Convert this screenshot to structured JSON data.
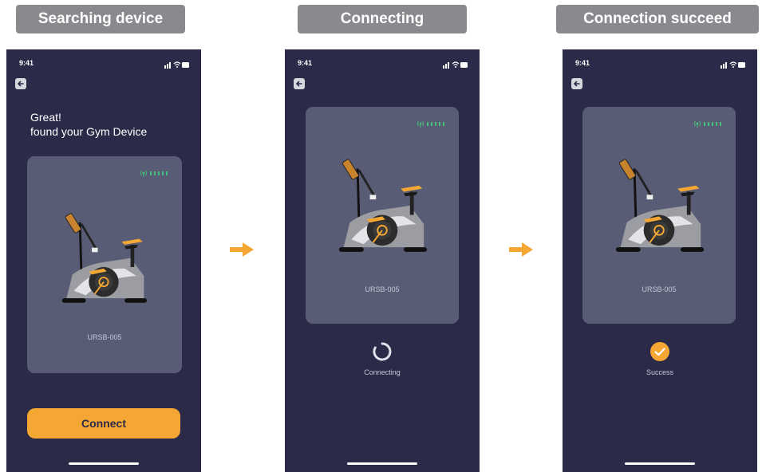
{
  "stages": [
    {
      "label": "Searching device",
      "time": "9:41",
      "greeting_line1": "Great!",
      "greeting_line2": "found your Gym Device",
      "device_name": "URSB-005",
      "connect_label": "Connect"
    },
    {
      "label": "Connecting",
      "time": "9:41",
      "device_name": "URSB-005",
      "status": "Connecting"
    },
    {
      "label": "Connection succeed",
      "time": "9:41",
      "device_name": "URSB-005",
      "status": "Success"
    }
  ],
  "icons": {
    "back": "back-arrow-icon",
    "signal": "device-signal-icon",
    "arrow": "right-arrow-icon",
    "spinner": "loading-spinner-icon",
    "success": "check-circle-icon"
  },
  "colors": {
    "phone_bg": "#2b2a48",
    "card_bg": "#585c74",
    "accent": "#f5a733",
    "label_bg": "#8a8a8e",
    "signal": "#46c07a"
  }
}
